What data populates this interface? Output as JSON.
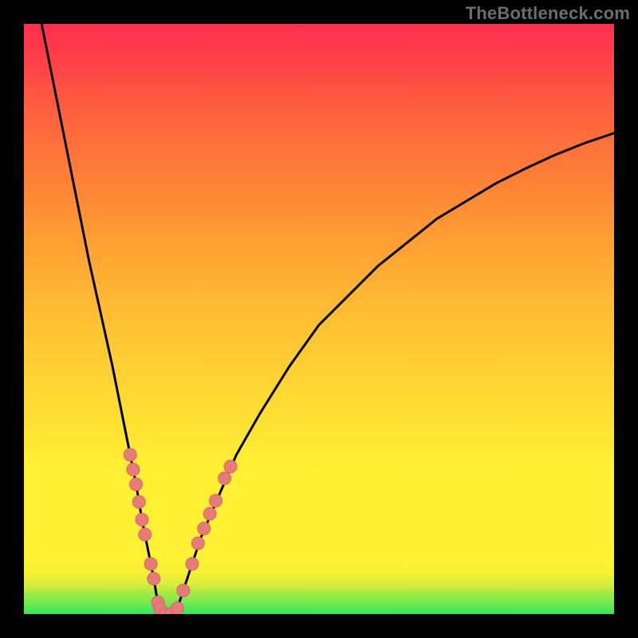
{
  "watermark": "TheBottleneck.com",
  "colors": {
    "frame": "#000000",
    "curve": "#000000",
    "marker_fill": "#e87a7a",
    "marker_stroke": "#d46868",
    "gradient_top": "#ff2f4f",
    "gradient_bottom": "#2ee85f"
  },
  "chart_data": {
    "type": "line",
    "title": "",
    "xlabel": "",
    "ylabel": "",
    "xlim": [
      0,
      100
    ],
    "ylim": [
      0,
      100
    ],
    "grid": false,
    "series": [
      {
        "name": "bottleneck-curve",
        "x": [
          3,
          5,
          7,
          9,
          11,
          13,
          15,
          16,
          17,
          18,
          19,
          20,
          21,
          22,
          22.5,
          23,
          24,
          25,
          26,
          27,
          28,
          30,
          33,
          36,
          40,
          45,
          50,
          55,
          60,
          65,
          70,
          75,
          80,
          85,
          90,
          95,
          100
        ],
        "values": [
          100,
          90,
          80,
          70,
          60,
          51,
          42,
          37,
          32,
          27,
          22,
          16,
          11,
          6,
          3,
          1,
          0,
          0,
          1,
          4,
          7,
          13,
          20,
          27,
          34,
          42,
          49,
          54,
          59,
          63,
          67,
          70,
          73,
          75.5,
          77.8,
          79.8,
          81.5
        ]
      }
    ],
    "markers": {
      "name": "scatter-points",
      "points": [
        {
          "x": 18.0,
          "y": 27.0
        },
        {
          "x": 18.5,
          "y": 24.5
        },
        {
          "x": 19.0,
          "y": 22.0
        },
        {
          "x": 19.5,
          "y": 19.0
        },
        {
          "x": 20.0,
          "y": 16.0
        },
        {
          "x": 20.5,
          "y": 13.5
        },
        {
          "x": 21.5,
          "y": 8.5
        },
        {
          "x": 22.0,
          "y": 6.0
        },
        {
          "x": 22.7,
          "y": 2.0
        },
        {
          "x": 23.0,
          "y": 1.0
        },
        {
          "x": 24.0,
          "y": 0.0
        },
        {
          "x": 25.0,
          "y": 0.0
        },
        {
          "x": 26.0,
          "y": 1.0
        },
        {
          "x": 27.0,
          "y": 4.0
        },
        {
          "x": 28.5,
          "y": 8.5
        },
        {
          "x": 29.5,
          "y": 12.0
        },
        {
          "x": 30.5,
          "y": 14.5
        },
        {
          "x": 31.5,
          "y": 17.0
        },
        {
          "x": 32.5,
          "y": 19.2
        },
        {
          "x": 34.0,
          "y": 23.0
        },
        {
          "x": 35.0,
          "y": 25.0
        }
      ]
    }
  }
}
